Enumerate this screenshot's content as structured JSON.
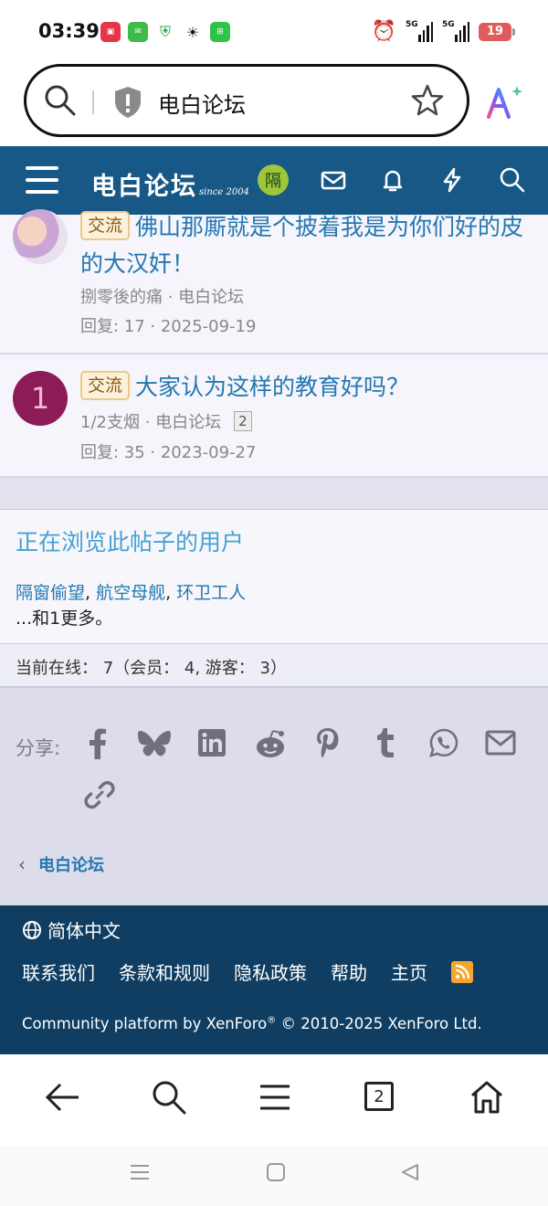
{
  "status_bar": {
    "time": "03:39",
    "signal1_label": "5G",
    "signal2_label": "5G",
    "battery": "19"
  },
  "address_bar": {
    "url_text": "电白论坛"
  },
  "forum_header": {
    "logo_text": "电白论坛",
    "logo_since": "since 2004",
    "user_avatar_letter": "隔"
  },
  "threads": [
    {
      "tag": "交流",
      "title": "佛山那厮就是个披着我是为你们好的皮的大汉奸！",
      "meta": "捌零後的痛 · 电白论坛",
      "replies": "回复: 17 · 2025-09-19"
    },
    {
      "avatar_letter": "1",
      "tag": "交流",
      "title": "大家认为这样的教育好吗？",
      "meta": "1/2支烟 · 电白论坛",
      "pages": "2",
      "replies": "回复: 35 · 2023-09-27"
    }
  ],
  "viewers": {
    "title": "正在浏览此帖子的用户",
    "users": [
      "隔窗偷望",
      "航空母舰",
      "环卫工人"
    ],
    "more": "...和1更多。"
  },
  "online": "当前在线：  7（会员：  4, 游客：  3）",
  "share": {
    "label": "分享:"
  },
  "breadcrumb": "电白论坛",
  "footer": {
    "language": "简体中文",
    "links": [
      "联系我们",
      "条款和规则",
      "隐私政策",
      "帮助",
      "主页"
    ],
    "copyright": "Community platform by XenForo",
    "copyright_suffix": " © 2010-2025 XenForo Ltd."
  },
  "browser_nav": {
    "tab_count": "2"
  },
  "colors": {
    "header_bg": "#185886",
    "footer_bg": "#0f3e62",
    "link": "#2577b1",
    "tag_bg": "#fdf1db"
  }
}
